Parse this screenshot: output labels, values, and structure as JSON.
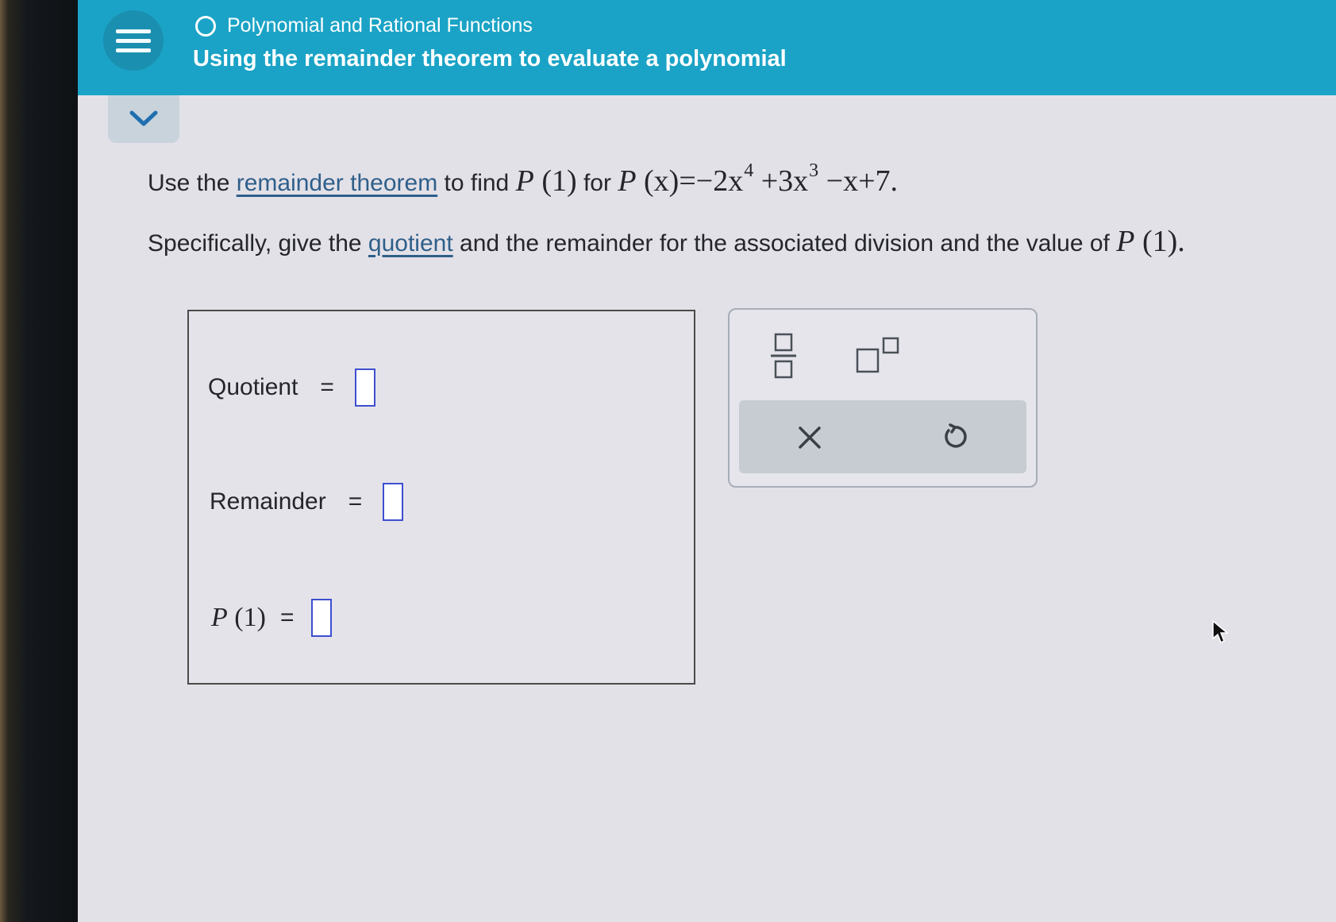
{
  "header": {
    "topic": "Polynomial and Rational Functions",
    "lesson_title": "Using the remainder theorem to evaluate a polynomial"
  },
  "question": {
    "line1_prefix": "Use the ",
    "line1_link": "remainder theorem",
    "line1_middle": " to find ",
    "line1_for": " for ",
    "line2_prefix": "Specifically, give the ",
    "line2_link": "quotient",
    "line2_suffix": " and the remainder for the associated division and the value of ",
    "math": {
      "P": "P",
      "one": "(1)",
      "x": "(x)",
      "poly_a": "=−2x",
      "exp4": "4",
      "poly_b": "+3x",
      "exp3": "3",
      "poly_c": "−x+7",
      "period": "."
    }
  },
  "answers": {
    "quotient_label": "Quotient",
    "remainder_label": "Remainder",
    "p1_label": "P",
    "p1_arg": "(1)",
    "equals": "=",
    "quotient_value": "",
    "remainder_value": "",
    "p1_value": ""
  },
  "toolpad": {
    "tools": [
      "fraction-icon",
      "superscript-icon"
    ],
    "actions": [
      "clear-icon",
      "undo-icon"
    ]
  },
  "colors": {
    "header_bg": "#1aa3c6",
    "link": "#2f5f8a",
    "input_border": "#3d4fd0",
    "page_bg": "#e3e1e8"
  }
}
